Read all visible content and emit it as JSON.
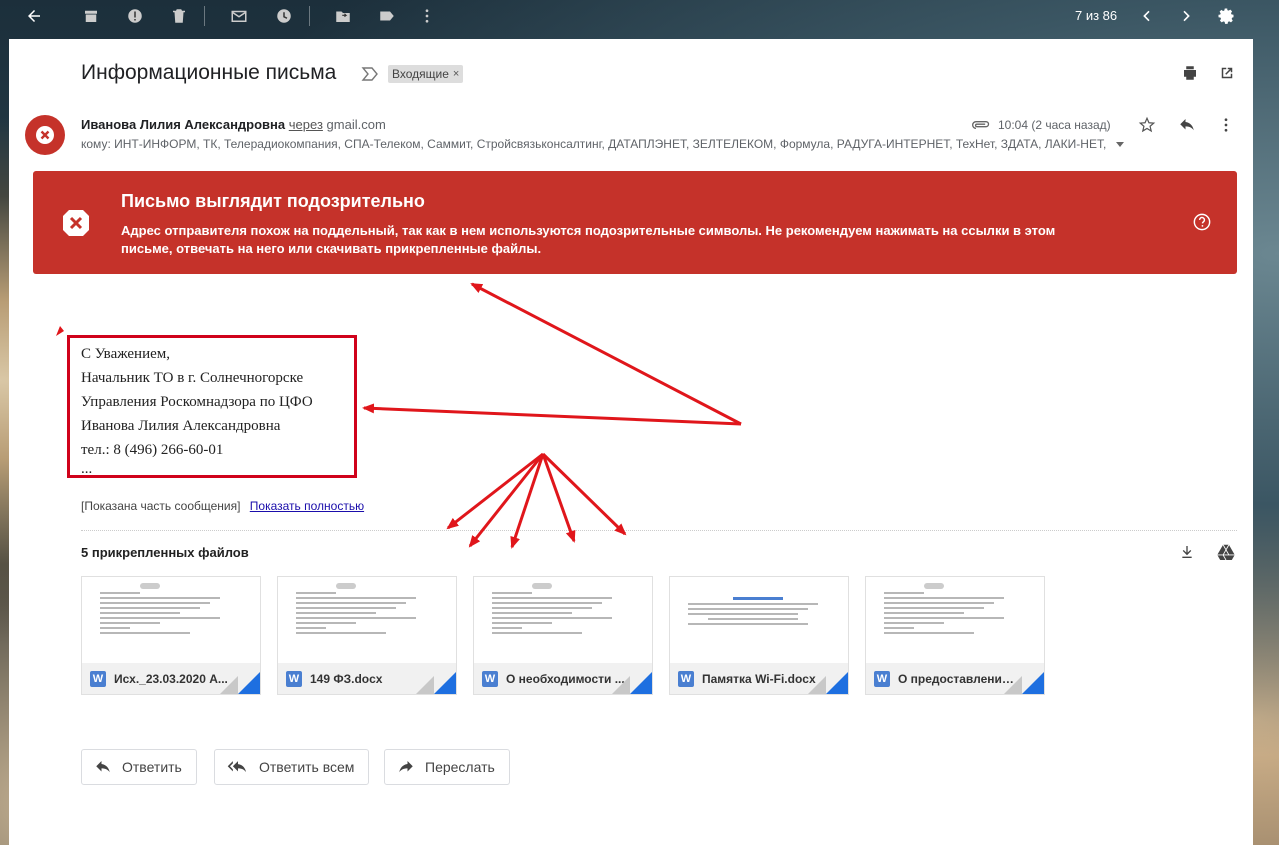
{
  "toolbar": {
    "pager": "7 из 86"
  },
  "message": {
    "subject": "Информационные письма",
    "label": "Входящие",
    "label_remove": "×",
    "sender_name": "Иванова Лилия Александровна",
    "via_text": "через",
    "via_domain": "gmail.com",
    "recipients": "кому: ИНТ-ИНФОРМ, ТК, Телерадиокомпания, СПА-Телеком, Саммит, Стройсвязьконсалтинг, ДАТАПЛЭНЕТ, ЗЕЛТЕЛЕКОМ, Формула, РАДУГА-ИНТЕРНЕТ, ТехНет, ЗДАТА, ЛАКИ-НЕТ,",
    "time": "10:04 (2 часа назад)"
  },
  "warning": {
    "title": "Письмо выглядит подозрительно",
    "body": "Адрес отправителя похож на поддельный, так как в нем используются подозрительные символы. Не рекомендуем нажимать на ссылки в этом письме, отвечать на него или скачивать прикрепленные файлы.",
    "color": "#c5322a"
  },
  "signature": {
    "lines": [
      "С Уважением,",
      "Начальник ТО в г. Солнечногорске",
      "Управления Роскомнадзора по ЦФО",
      "Иванова Лилия Александровна",
      "тел.: 8 (496) 266-60-01",
      "..."
    ]
  },
  "clipped": {
    "note": "[Показана часть сообщения]",
    "link": "Показать полностью"
  },
  "attachments": {
    "title": "5 прикрепленных файлов",
    "files": [
      {
        "name": "Исх._23.03.2020 А...",
        "icon": "word-icon"
      },
      {
        "name": "149 ФЗ.docx",
        "icon": "word-icon"
      },
      {
        "name": "О необходимости ...",
        "icon": "word-icon"
      },
      {
        "name": "Памятка Wi-Fi.docx",
        "icon": "word-icon"
      },
      {
        "name": "О предоставлении...",
        "icon": "word-icon"
      }
    ],
    "word_letter": "W"
  },
  "actions": {
    "reply": "Ответить",
    "reply_all": "Ответить всем",
    "forward": "Переслать"
  },
  "annotation_color": "#e0161b"
}
